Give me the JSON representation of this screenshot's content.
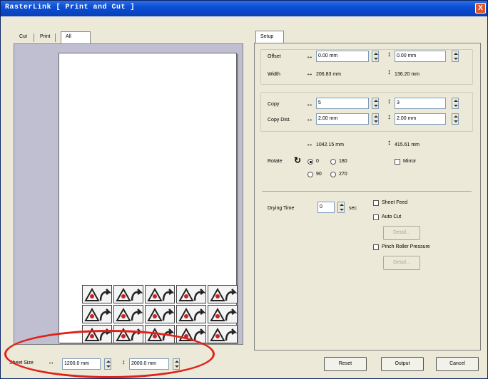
{
  "window": {
    "title": "RasterLink [ Print and Cut ]",
    "close_glyph": "X"
  },
  "tabs": [
    {
      "label": "Cut"
    },
    {
      "label": "Print"
    },
    {
      "label": "All"
    }
  ],
  "sheet": {
    "label": "Sheet Size",
    "width": "1200.0 mm",
    "height": "2000.0 mm"
  },
  "setup": {
    "tab_label": "Setup",
    "offset": {
      "label": "Offset",
      "x": "0.00 mm",
      "y": "0.00 mm"
    },
    "width": {
      "label": "Width",
      "x": "206.83 mm",
      "y": "136.20 mm"
    },
    "copy": {
      "label": "Copy",
      "x": "5",
      "y": "3"
    },
    "copy_dist": {
      "label": "Copy Dist.",
      "x": "2.00 mm",
      "y": "2.00 mm"
    },
    "size": {
      "x": "1042.15 mm",
      "y": "415.61 mm"
    },
    "rotate": {
      "label": "Rotate",
      "options": [
        "0",
        "180",
        "90",
        "270"
      ],
      "selected": "0"
    },
    "mirror": {
      "label": "Mirror",
      "checked": false
    },
    "drying": {
      "label": "Drying Time",
      "value": "0",
      "unit": "sec"
    },
    "sheet_feed": {
      "label": "Sheet Feed",
      "checked": false
    },
    "auto_cut": {
      "label": "Auto Cut",
      "checked": false
    },
    "detail_label_1": "Detail...",
    "pinch": {
      "label": "Pinch Roller Pressure",
      "checked": false
    },
    "detail_label_2": "Detail..."
  },
  "buttons": {
    "reset": "Reset",
    "output": "Output",
    "cancel": "Cancel"
  },
  "colors": {
    "titlebar": "#0b4fd8",
    "highlight": "#e0211a",
    "preview_bg": "#c0bfd2"
  },
  "icons": {
    "close": "close-icon",
    "horizontal": "horizontal-arrow-icon",
    "vertical": "vertical-arrow-icon",
    "rotate": "rotate-icon",
    "mark": "registration-mark-icon"
  }
}
